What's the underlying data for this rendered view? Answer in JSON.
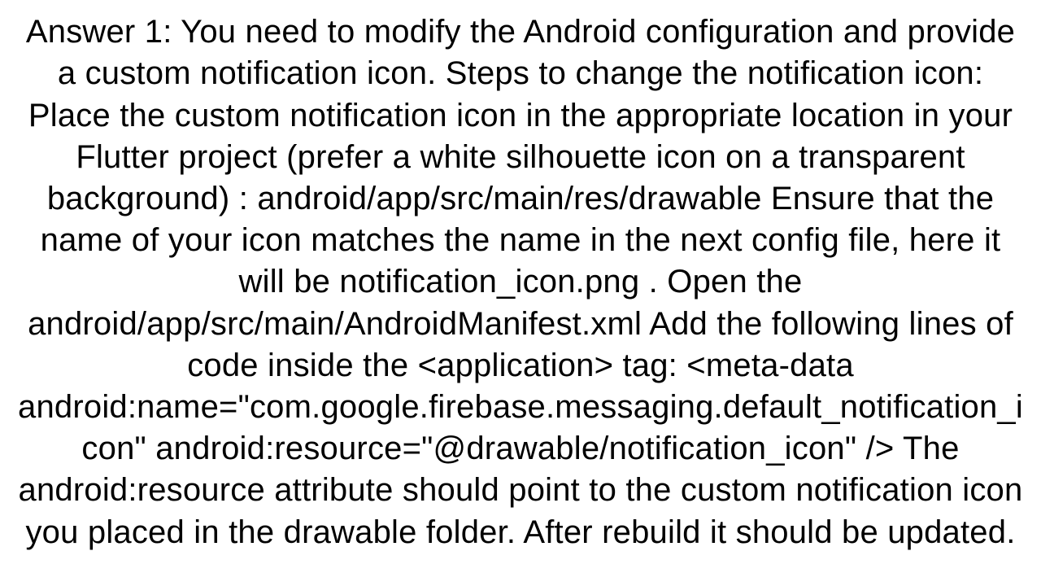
{
  "answer": {
    "text": "Answer 1: You need to modify the Android configuration and provide a custom notification icon. Steps to change the notification icon: Place the custom notification icon in the appropriate location in your Flutter project (prefer a white silhouette icon on a transparent background) : android/app/src/main/res/drawable Ensure that the name of your icon matches the name in the next config file, here it will be notification_icon.png . Open the android/app/src/main/AndroidManifest.xml Add the following lines of code inside the <application> tag: <meta-data android:name=\"com.google.firebase.messaging.default_notification_icon\"     android:resource=\"@drawable/notification_icon\" /> The android:resource attribute should point to the custom notification icon you placed in the drawable folder. After rebuild it should be updated."
  }
}
